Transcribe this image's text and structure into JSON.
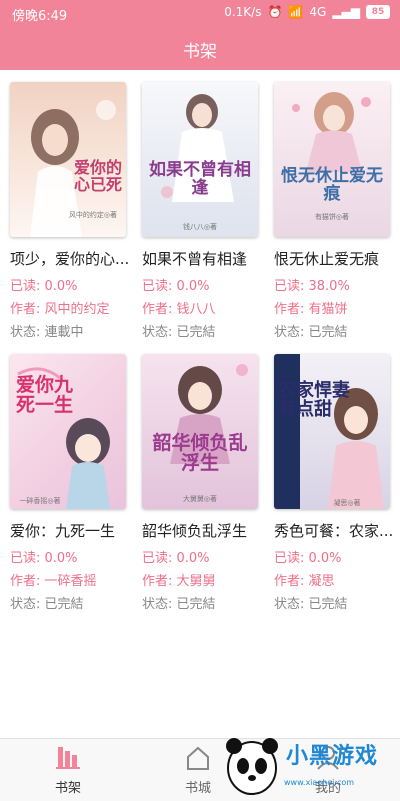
{
  "status_bar": {
    "time": "傍晚6:49",
    "speed": "0.1K/s",
    "network": "4G",
    "battery": "85"
  },
  "header": {
    "title": "书架"
  },
  "books": [
    {
      "title": "项少，爱你的心...",
      "read_label": "已读: 0.0%",
      "author_label": "作者: 风中的约定",
      "status_label": "状态: 連載中",
      "cover_title": "爱你的心已死",
      "cover_author": "风中的约定◎著",
      "cover_bg": "#f4dccd"
    },
    {
      "title": "如果不曾有相逢",
      "read_label": "已读: 0.0%",
      "author_label": "作者: 钱八八",
      "status_label": "状态: 已完結",
      "cover_title": "如果不曾有相逢",
      "cover_author": "钱八八◎著",
      "cover_bg": "#eef0f6"
    },
    {
      "title": "恨无休止爱无痕",
      "read_label": "已读: 38.0%",
      "author_label": "作者: 有猫饼",
      "status_label": "状态: 已完結",
      "cover_title": "恨无休止爱无痕",
      "cover_author": "有猫饼◎著",
      "cover_bg": "#f5e9ee"
    },
    {
      "title": "爱你：九死一生",
      "read_label": "已读: 0.0%",
      "author_label": "作者: 一碎香摇",
      "status_label": "状态: 已完結",
      "cover_title": "爱你九死一生",
      "cover_author": "一碎香摇◎著",
      "cover_bg": "#f6dde7"
    },
    {
      "title": "韶华倾负乱浮生",
      "read_label": "已读: 0.0%",
      "author_label": "作者: 大舅舅",
      "status_label": "状态: 已完結",
      "cover_title": "韶华倾负乱浮生",
      "cover_author": "大舅舅◎著",
      "cover_bg": "#eed6e6"
    },
    {
      "title": "秀色可餐：农家...",
      "read_label": "已读: 0.0%",
      "author_label": "作者: 凝思",
      "status_label": "状态: 已完結",
      "cover_title": "农家悍妻有点甜",
      "cover_author": "凝思◎著",
      "cover_bg": "#e6e2ee"
    }
  ],
  "nav": [
    {
      "label": "书架",
      "icon": "bookshelf-icon",
      "active": true
    },
    {
      "label": "书城",
      "icon": "bookstore-icon",
      "active": false
    },
    {
      "label": "我的",
      "icon": "profile-icon",
      "active": false
    }
  ],
  "watermark": {
    "text": "小黑游戏",
    "url": "www.xiaohei.com"
  },
  "colors": {
    "accent": "#f2849a",
    "pink_text": "#ee6f8a",
    "status_gray": "#888888"
  }
}
